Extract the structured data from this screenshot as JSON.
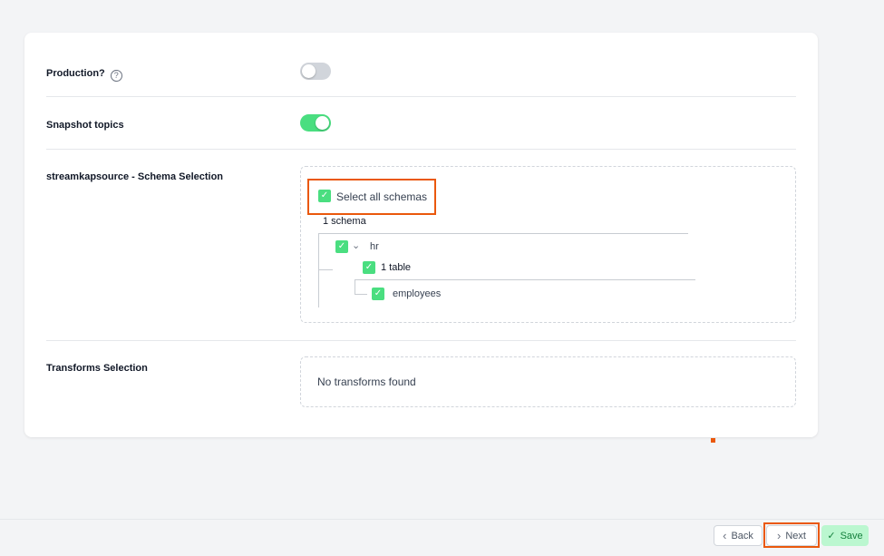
{
  "fields": {
    "production": {
      "label": "Production?",
      "help_icon": "?",
      "enabled": false
    },
    "snapshot_topics": {
      "label": "Snapshot topics",
      "enabled": true
    },
    "schema_selection": {
      "label": "streamkapsource - Schema Selection",
      "select_all_label": "Select all schemas",
      "schema_count": "1 schema",
      "schemas": [
        {
          "name": "hr",
          "table_count": "1 table",
          "tables": [
            {
              "name": "employees",
              "checked": true
            }
          ],
          "checked": true
        }
      ]
    },
    "transforms": {
      "label": "Transforms Selection",
      "empty_text": "No transforms found"
    }
  },
  "icons": {
    "check": "✓",
    "chevron_down": "⌄",
    "chevron_left": "‹",
    "chevron_right": "›"
  },
  "footer": {
    "back_label": "Back",
    "next_label": "Next",
    "save_label": "Save"
  },
  "colors": {
    "accent_green": "#4ade80",
    "highlight_orange": "#ea580c",
    "save_bg": "#bbf7d0"
  }
}
